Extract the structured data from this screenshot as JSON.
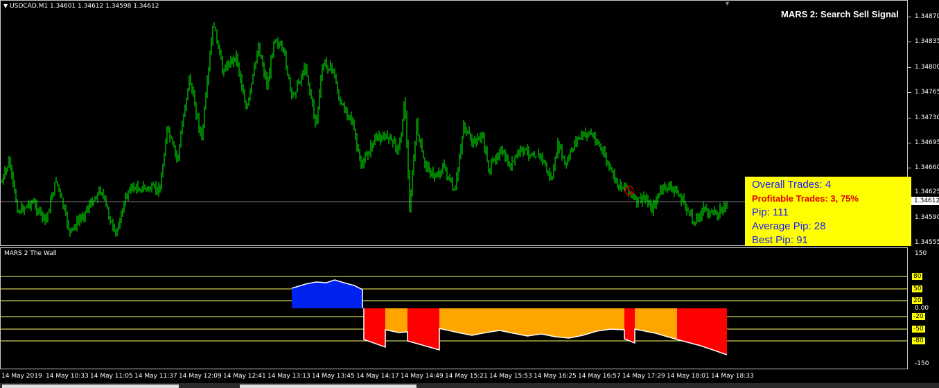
{
  "chart": {
    "symbol_info": "USDCAD,M1  1.34601 1.34612 1.34598 1.34612",
    "signal_title": "MARS 2: Search Sell Signal",
    "current_price": "1.34612",
    "price_axis": [
      "1.34870",
      "1.34835",
      "1.34800",
      "1.34765",
      "1.34730",
      "1.34695",
      "1.34660",
      "1.34625",
      "1.34590",
      "1.34555"
    ],
    "colors": {
      "candle": "#00ff00",
      "background": "#000000",
      "grid": "#c8c8c8",
      "stats_bg": "#ffff00"
    }
  },
  "stats": {
    "overall_trades": "Overall Trades: 4",
    "profitable_trades": "Profitable Trades: 3, 75%",
    "pip": "Pip: 111",
    "average_pip": "Average Pip: 28",
    "best_pip": "Best Pip: 91"
  },
  "indicator": {
    "name": "MARS 2 The Wall",
    "axis": {
      "top": "150",
      "l80": "80",
      "l50": "50",
      "l20": "20",
      "zero": "0.00",
      "m20": "-20",
      "m50": "-50",
      "m80": "-80",
      "bottom": "-150"
    },
    "colors": {
      "buy": "#0022ee",
      "sell_red": "#ff0000",
      "sell_orange": "#ffa500",
      "levels": "#ffff66"
    }
  },
  "time_axis": [
    "14 May 2019",
    "14 May 10:33",
    "14 May 11:05",
    "14 May 11:37",
    "14 May 12:09",
    "14 May 12:41",
    "14 May 13:13",
    "14 May 13:45",
    "14 May 14:17",
    "14 May 14:49",
    "14 May 15:21",
    "14 May 15:53",
    "14 May 16:25",
    "14 May 16:57",
    "14 May 17:29",
    "14 May 18:01",
    "14 May 18:33"
  ]
}
